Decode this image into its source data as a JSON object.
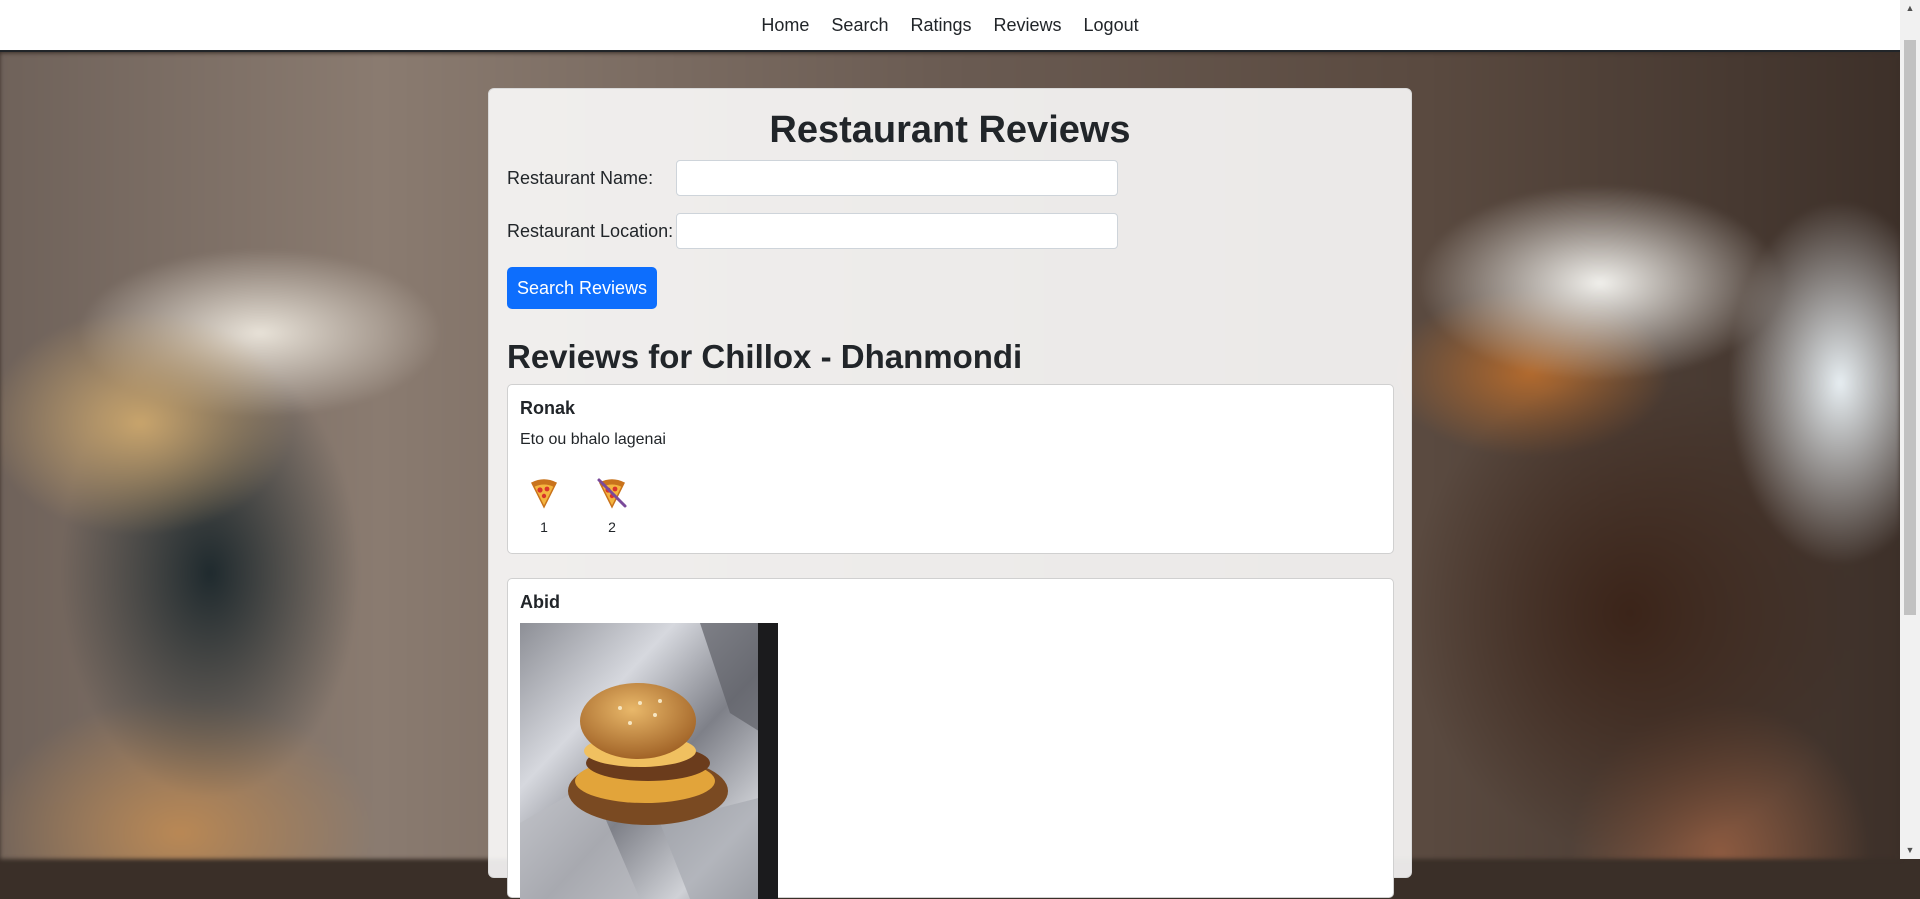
{
  "nav": {
    "items": [
      "Home",
      "Search",
      "Ratings",
      "Reviews",
      "Logout"
    ]
  },
  "page": {
    "title": "Restaurant Reviews"
  },
  "form": {
    "name_label": "Restaurant Name:",
    "name_value": "",
    "location_label": "Restaurant Location:",
    "location_value": "",
    "button_label": "Search Reviews"
  },
  "results": {
    "heading": "Reviews for Chillox - Dhanmondi",
    "reviews": [
      {
        "author": "Ronak",
        "text": "Eto ou bhalo lagenai",
        "reactions": [
          {
            "icon": "pizza-slice-icon",
            "count": "1"
          },
          {
            "icon": "pizza-slice-crossed-icon",
            "count": "2"
          }
        ]
      },
      {
        "author": "Abid",
        "photo_icon": "burger-photo"
      }
    ]
  },
  "colors": {
    "accent": "#0d6efd",
    "text": "#212529"
  }
}
